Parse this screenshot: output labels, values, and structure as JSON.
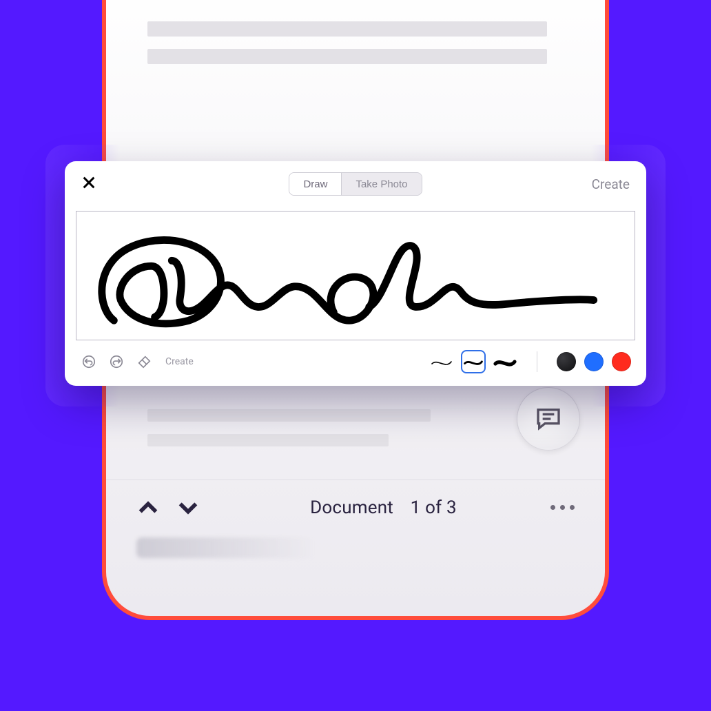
{
  "modal": {
    "tabs": {
      "draw": "Draw",
      "photo": "Take Photo",
      "active": "draw"
    },
    "action": "Create",
    "toolbar_label": "Create",
    "thickness_options": [
      "thin",
      "medium",
      "thick"
    ],
    "thickness_selected": "medium",
    "colors": [
      "black",
      "blue",
      "red"
    ],
    "color_selected": "black"
  },
  "nav": {
    "label": "Document",
    "page_indicator": "1 of 3"
  }
}
